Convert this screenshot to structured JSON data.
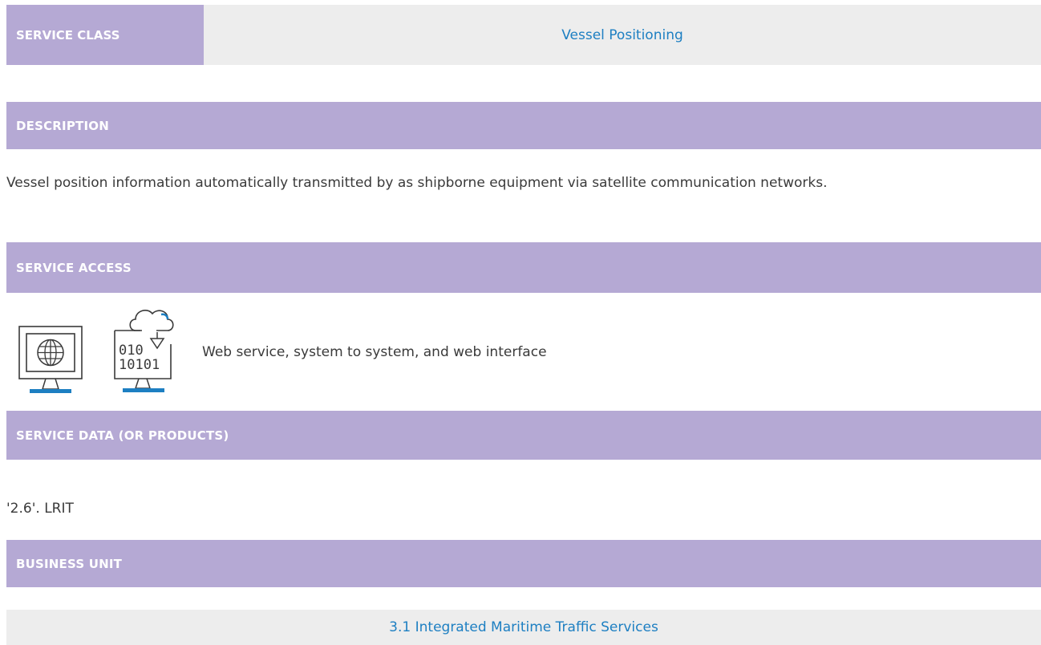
{
  "service_class": {
    "label": "SERVICE CLASS",
    "value": "Vessel Positioning"
  },
  "description": {
    "header": "DESCRIPTION",
    "text": "Vessel position information automatically transmitted by as shipborne equipment via satellite communication networks."
  },
  "service_access": {
    "header": "SERVICE ACCESS",
    "text": "Web service, system to system, and web interface",
    "icons": [
      "globe-monitor-icon",
      "cloud-data-monitor-icon"
    ],
    "data_lines": [
      "010",
      "10101"
    ]
  },
  "service_data": {
    "header": "SERVICE DATA (OR PRODUCTS)",
    "text": "'2.6'. LRIT"
  },
  "business_unit": {
    "header": "BUSINESS UNIT",
    "value": "3.1 Integrated Maritime Traffic Services"
  },
  "colors": {
    "band": "#b5a9d4",
    "accent": "#1d7fc2",
    "panel": "#ededed"
  }
}
